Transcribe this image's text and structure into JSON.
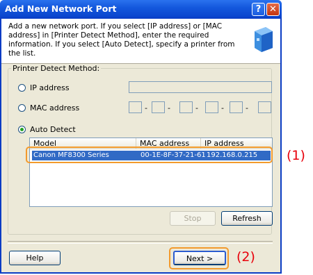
{
  "window": {
    "title": "Add New Network Port",
    "help_btn": "?",
    "close_btn": "✕"
  },
  "description": "Add a new network port. If you select [IP address] or [MAC address] in [Printer Detect Method], enter the required information. If you select [Auto Detect], specify a printer from the list.",
  "group": {
    "label": "Printer Detect Method:",
    "options": [
      {
        "label": "IP address",
        "selected": false
      },
      {
        "label": "MAC address",
        "selected": false
      },
      {
        "label": "Auto Detect",
        "selected": true
      }
    ],
    "ip_value": "",
    "mac_separator": "-"
  },
  "list": {
    "columns": [
      "Model",
      "MAC address",
      "IP address"
    ],
    "rows": [
      {
        "model": "Canon MF8300 Series",
        "mac": "00-1E-8F-37-21-61",
        "ip": "192.168.0.215",
        "selected": true
      }
    ]
  },
  "buttons": {
    "stop": "Stop",
    "refresh": "Refresh",
    "help": "Help",
    "next": "Next >"
  },
  "callouts": {
    "one": "(1)",
    "two": "(2)"
  },
  "colors": {
    "titlebar": "#0b47cf",
    "selection": "#316ac5",
    "callout_border": "#f39a2c",
    "callout_text": "#e8000b",
    "radio_dot": "#21a121"
  }
}
